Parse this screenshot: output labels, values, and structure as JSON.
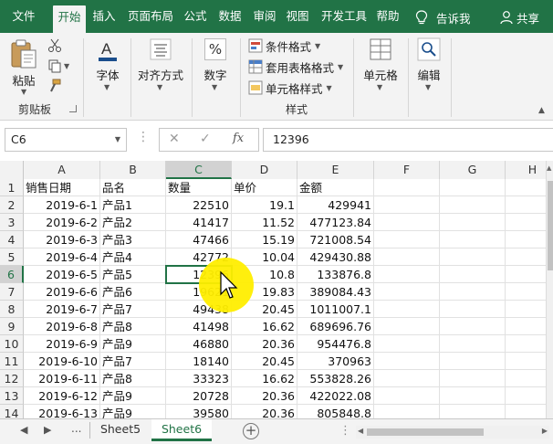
{
  "ribbon_tabs": [
    "文件",
    "开始",
    "插入",
    "页面布局",
    "公式",
    "数据",
    "审阅",
    "视图",
    "开发工具",
    "帮助"
  ],
  "active_tab": "开始",
  "tell_me": "告诉我",
  "share": "共享",
  "clipboard": {
    "paste": "粘贴",
    "group_label": "剪贴板"
  },
  "font_group": {
    "label": "字体"
  },
  "align_group": {
    "label": "对齐方式"
  },
  "number_group": {
    "label": "数字",
    "icon_text": "%"
  },
  "styles": {
    "conditional": "条件格式",
    "table_format": "套用表格格式",
    "cell_styles": "单元格样式",
    "group_label": "样式"
  },
  "cells_group": {
    "label": "单元格"
  },
  "editing_group": {
    "label": "编辑"
  },
  "formula_bar": {
    "name_box": "C6",
    "fx": "fx",
    "value": "12396"
  },
  "columns": [
    "A",
    "B",
    "C",
    "D",
    "E",
    "F",
    "G",
    "H"
  ],
  "selected_column": "C",
  "selected_row": "6",
  "rows": [
    {
      "n": "1",
      "a": "销售日期",
      "b": "品名",
      "c": "数量",
      "d": "单价",
      "e": "金额"
    },
    {
      "n": "2",
      "a": "2019-6-1",
      "b": "产品1",
      "c": "22510",
      "d": "19.1",
      "e": "429941"
    },
    {
      "n": "3",
      "a": "2019-6-2",
      "b": "产品2",
      "c": "41417",
      "d": "11.52",
      "e": "477123.84"
    },
    {
      "n": "4",
      "a": "2019-6-3",
      "b": "产品3",
      "c": "47466",
      "d": "15.19",
      "e": "721008.54"
    },
    {
      "n": "5",
      "a": "2019-6-4",
      "b": "产品4",
      "c": "42772",
      "d": "10.04",
      "e": "429430.88"
    },
    {
      "n": "6",
      "a": "2019-6-5",
      "b": "产品5",
      "c": "12396",
      "d": "10.8",
      "e": "133876.8"
    },
    {
      "n": "7",
      "a": "2019-6-6",
      "b": "产品6",
      "c": "19621",
      "d": "19.83",
      "e": "389084.43"
    },
    {
      "n": "8",
      "a": "2019-6-7",
      "b": "产品7",
      "c": "49438",
      "d": "20.45",
      "e": "1011007.1"
    },
    {
      "n": "9",
      "a": "2019-6-8",
      "b": "产品8",
      "c": "41498",
      "d": "16.62",
      "e": "689696.76"
    },
    {
      "n": "10",
      "a": "2019-6-9",
      "b": "产品9",
      "c": "46880",
      "d": "20.36",
      "e": "954476.8"
    },
    {
      "n": "11",
      "a": "2019-6-10",
      "b": "产品7",
      "c": "18140",
      "d": "20.45",
      "e": "370963"
    },
    {
      "n": "12",
      "a": "2019-6-11",
      "b": "产品8",
      "c": "33323",
      "d": "16.62",
      "e": "553828.26"
    },
    {
      "n": "13",
      "a": "2019-6-12",
      "b": "产品9",
      "c": "20728",
      "d": "20.36",
      "e": "422022.08"
    },
    {
      "n": "14",
      "a": "2019-6-13",
      "b": "产品9",
      "c": "39580",
      "d": "20.36",
      "e": "805848.8"
    }
  ],
  "sheet_nav": {
    "prev": "◀",
    "next": "▶",
    "more": "..."
  },
  "sheets": [
    "Sheet5",
    "Sheet6"
  ],
  "active_sheet": "Sheet6",
  "add_sheet": "+",
  "colors": {
    "excel_green": "#217346",
    "ribbon_bg": "#f3f3f3",
    "cursor_highlight": "#ffee00"
  }
}
